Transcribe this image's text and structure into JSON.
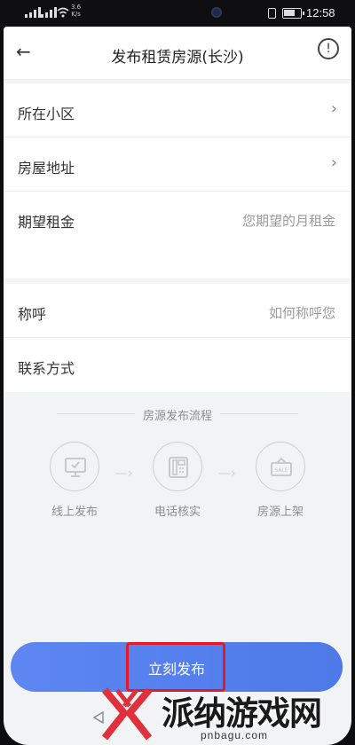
{
  "status_bar": {
    "network_speed": "3.6",
    "network_unit": "K/s",
    "time": "12:58"
  },
  "header": {
    "title": "发布租赁房源(长沙)",
    "back_icon": "back-arrow-icon",
    "info_icon": "info-icon"
  },
  "form": {
    "community_label": "所在小区",
    "address_label": "房屋地址",
    "rent_label": "期望租金",
    "rent_placeholder": "您期望的月租金",
    "name_label": "称呼",
    "name_placeholder": "如何称呼您",
    "contact_label": "联系方式"
  },
  "flow": {
    "title": "房源发布流程",
    "steps": [
      {
        "label": "线上发布",
        "icon": "monitor-icon"
      },
      {
        "label": "电话核实",
        "icon": "phone-icon"
      },
      {
        "label": "房源上架",
        "icon": "sale-sign-icon"
      }
    ]
  },
  "publish_button": {
    "label": "立刻发布",
    "color": "#5580EE",
    "highlight_color": "#E3192B"
  },
  "watermark": {
    "text": "派纳游戏网",
    "url": "pnbagu.com"
  }
}
